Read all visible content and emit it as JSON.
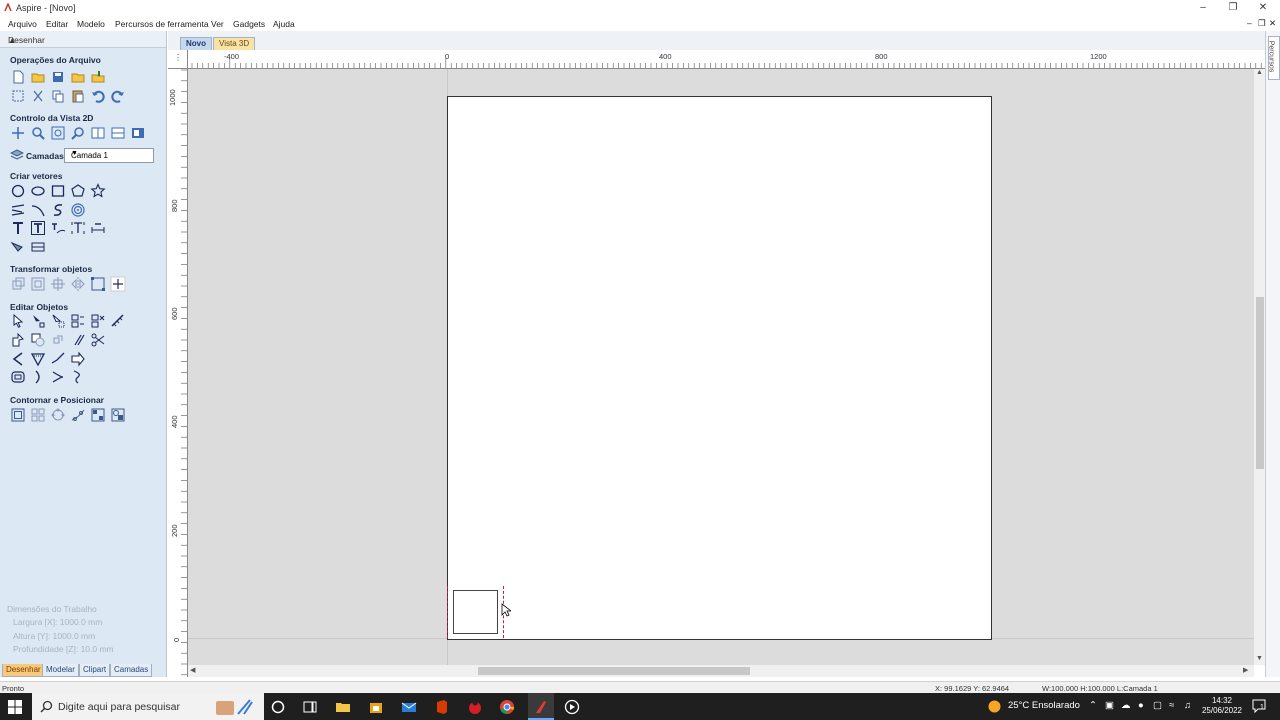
{
  "window": {
    "title": "Aspire - [Novo]"
  },
  "menubar": {
    "items": [
      "Arquivo",
      "Editar",
      "Modelo",
      "Percursos de ferramenta",
      "Ver",
      "Gadgets",
      "Ajuda"
    ]
  },
  "panel": {
    "title": "Desenhar",
    "sections": {
      "file_ops": "Operações do Arquivo",
      "view2d": "Controlo da Vista 2D",
      "layers_label": "Camadas",
      "layer_selected": "Camada 1",
      "create_vectors": "Criar vetores",
      "transform": "Transformar objetos",
      "edit_objects": "Editar Objetos",
      "offset_layout": "Contornar e Posicionar"
    },
    "job_dimensions": {
      "title": "Dimensões do Trabalho",
      "width": "Largura    [X]: 1000.0 mm",
      "height": "Altura     [Y]: 1000.0 mm",
      "depth": "Profundidade [Z]: 10.0 mm"
    },
    "bottom_tabs": [
      "Desenhar",
      "Modelar",
      "Clipart",
      "Camadas"
    ]
  },
  "doc_tabs": [
    "Novo",
    "Vista 3D"
  ],
  "ruler_top": [
    "-400",
    "0",
    "400",
    "800",
    "1200"
  ],
  "ruler_left": [
    "1000",
    "800",
    "600",
    "400",
    "200",
    "0"
  ],
  "right_panel": {
    "tab": "Percursos"
  },
  "status": {
    "left": "Pronto",
    "coords": "X: 99.1629 Y: 62.9464",
    "dims": "W:100.000   H:100.000   L:Camada 1"
  },
  "taskbar": {
    "search_placeholder": "Digite aqui para pesquisar",
    "weather": "25°C  Ensolarado",
    "time": "14:32",
    "date": "25/06/2022",
    "notifications": "1"
  },
  "colors": {
    "panel_bg": "#dce8f4",
    "accent_tab": "#f7c97a",
    "selection": "#c2185b",
    "taskbar": "#1f1f1f"
  }
}
